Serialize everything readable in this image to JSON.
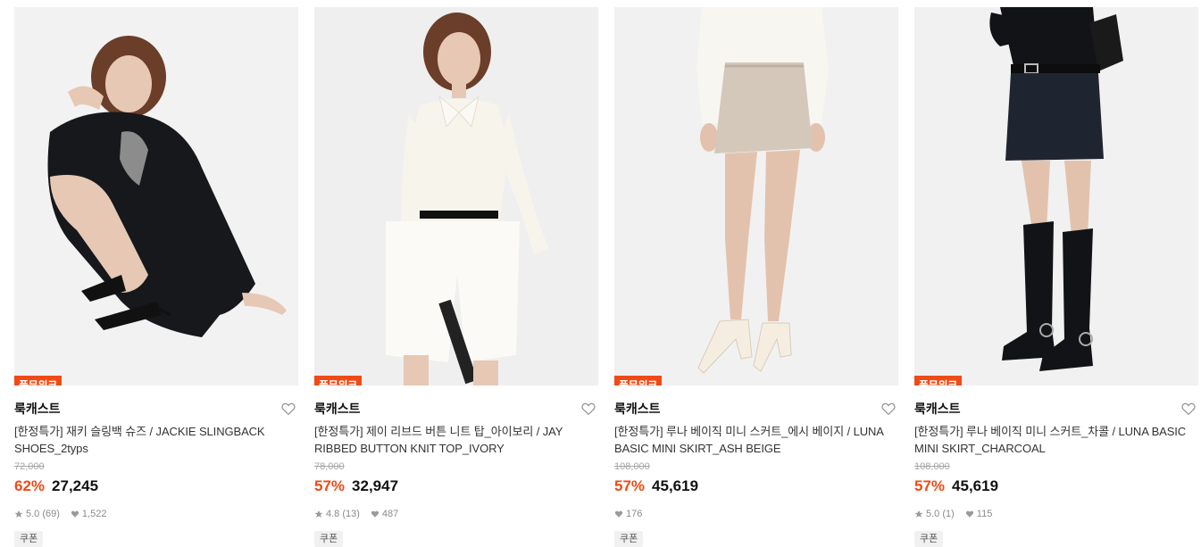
{
  "products": [
    {
      "badge": "풀문위크",
      "brand": "룩캐스트",
      "title": "[한정특가] 재키 슬링백 슈즈 / JACKIE SLINGBACK SHOES_2typs",
      "original_price": "72,000",
      "discount": "62%",
      "price": "27,245",
      "rating": "5.0 (69)",
      "likes": "1,522",
      "coupon": "쿠폰",
      "photo_colors": {
        "bg": "#f2f2f2",
        "garment": "#16181c",
        "skin": "#e6c8b4"
      }
    },
    {
      "badge": "풀문위크",
      "brand": "룩캐스트",
      "title": "[한정특가] 제이 리브드 버튼 니트 탑_아이보리 / JAY RIBBED BUTTON KNIT TOP_IVORY",
      "original_price": "78,000",
      "discount": "57%",
      "price": "32,947",
      "rating": "4.8 (13)",
      "likes": "487",
      "coupon": "쿠폰",
      "photo_colors": {
        "bg": "#efefef",
        "garment": "#f7f4ec",
        "skin": "#e6c8b4"
      }
    },
    {
      "badge": "풀문위크",
      "brand": "룩캐스트",
      "title": "[한정특가] 루나 베이직 미니 스커트_에시 베이지 / LUNA BASIC MINI SKIRT_ASH BEIGE",
      "original_price": "108,000",
      "discount": "57%",
      "price": "45,619",
      "rating": "",
      "likes": "176",
      "coupon": "쿠폰",
      "photo_colors": {
        "bg": "#f1f1f1",
        "garment": "#d4c8bb",
        "skin": "#e3c2ad"
      }
    },
    {
      "badge": "풀문위크",
      "brand": "룩캐스트",
      "title": "[한정특가] 루나 베이직 미니 스커트_차콜 / LUNA BASIC MINI SKIRT_CHARCOAL",
      "original_price": "108,000",
      "discount": "57%",
      "price": "45,619",
      "rating": "5.0 (1)",
      "likes": "115",
      "coupon": "쿠폰",
      "photo_colors": {
        "bg": "#f1f1f1",
        "garment": "#1f2530",
        "skin": "#e3c2ad"
      }
    }
  ],
  "colors": {
    "accent": "#f04a16",
    "badge_text": "#ffffff",
    "muted": "#8a8a8a"
  },
  "icons": {
    "wishlist": "heart-outline-icon",
    "rating": "star-icon",
    "likes": "heart-filled-icon"
  }
}
